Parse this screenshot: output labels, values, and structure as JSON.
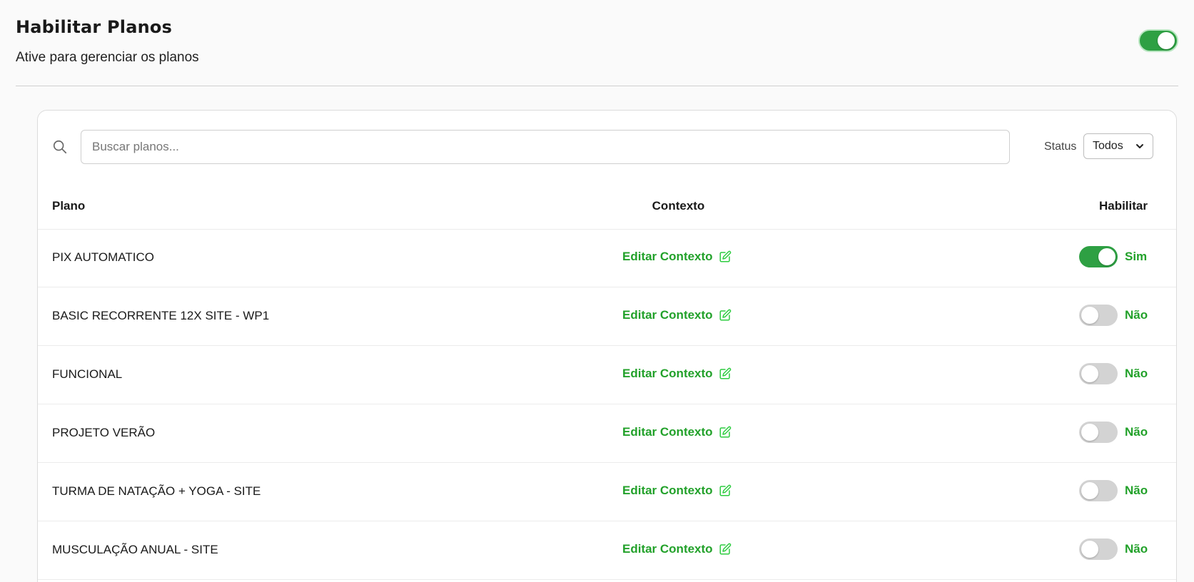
{
  "header": {
    "title": "Habilitar Planos",
    "subtitle": "Ative para gerenciar os planos",
    "enabled": true
  },
  "search": {
    "placeholder": "Buscar planos...",
    "value": ""
  },
  "filter": {
    "label": "Status",
    "selected": "Todos"
  },
  "table": {
    "columns": {
      "plano": "Plano",
      "contexto": "Contexto",
      "habilitar": "Habilitar"
    },
    "rows": [
      {
        "plan": "PIX AUTOMATICO",
        "action": "Editar Contexto",
        "enabled": true,
        "state_label": "Sim"
      },
      {
        "plan": "BASIC RECORRENTE 12X SITE - WP1",
        "action": "Editar Contexto",
        "enabled": false,
        "state_label": "Não"
      },
      {
        "plan": "FUNCIONAL",
        "action": "Editar Contexto",
        "enabled": false,
        "state_label": "Não"
      },
      {
        "plan": "PROJETO VERÃO",
        "action": "Editar Contexto",
        "enabled": false,
        "state_label": "Não"
      },
      {
        "plan": "TURMA DE NATAÇÃO + YOGA - SITE",
        "action": "Editar Contexto",
        "enabled": false,
        "state_label": "Não"
      },
      {
        "plan": "MUSCULAÇÃO ANUAL - SITE",
        "action": "Editar Contexto",
        "enabled": false,
        "state_label": "Não"
      }
    ]
  },
  "colors": {
    "accent_green": "#2ea043",
    "link_green": "#22a12a",
    "toggle_off": "#d3d3d3",
    "border": "#dcdcdc"
  },
  "icons": {
    "search": "search-icon",
    "edit": "edit-icon",
    "select_chevron": "chevron-down-icon"
  }
}
